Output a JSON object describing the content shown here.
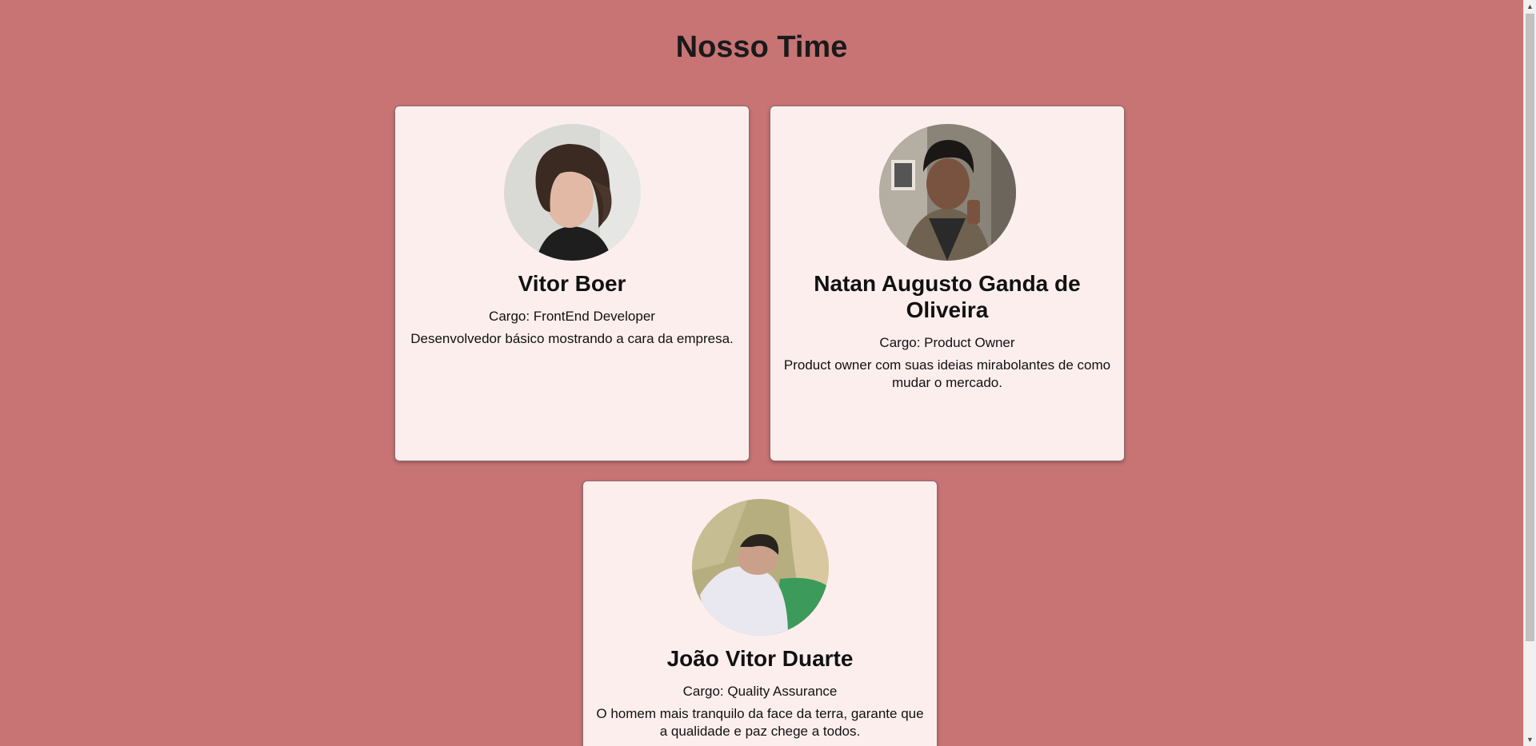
{
  "page": {
    "title": "Nosso Time"
  },
  "members": [
    {
      "name": "Vitor Boer",
      "role": "Cargo: FrontEnd Developer",
      "description": "Desenvolvedor básico mostrando a cara da empresa."
    },
    {
      "name": "Natan Augusto Ganda de Oliveira",
      "role": "Cargo: Product Owner",
      "description": "Product owner com suas ideias mirabolantes de como mudar o mercado."
    },
    {
      "name": "João Vitor Duarte",
      "role": "Cargo: Quality Assurance",
      "description": "O homem mais tranquilo da face da terra, garante que a qualidade e paz chege a todos."
    }
  ],
  "colors": {
    "background": "#c87474",
    "card": "#fdeeee"
  },
  "scrollbar": {
    "up_icon": "▲",
    "down_icon": "▼"
  }
}
